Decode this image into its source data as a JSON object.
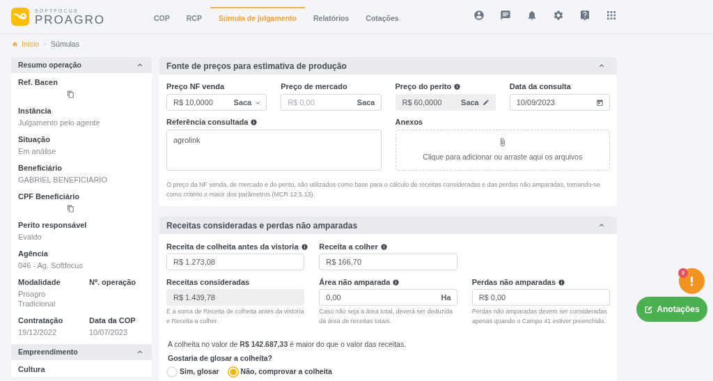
{
  "header": {
    "logo": {
      "brand": "SOFTFOCUS",
      "product": "PROAGRO"
    },
    "nav": [
      {
        "label": "COP",
        "selected": false
      },
      {
        "label": "RCP",
        "selected": false
      },
      {
        "label": "Súmula de julgamento",
        "selected": true
      },
      {
        "label": "Relatórios",
        "selected": false
      },
      {
        "label": "Cotações",
        "selected": false
      }
    ]
  },
  "breadcrumb": [
    {
      "label": "Início",
      "kind": "link"
    },
    {
      "label": "Súmulas",
      "kind": "current"
    }
  ],
  "sidebar": {
    "sections": [
      {
        "title": "Resumo operação",
        "expanded": true,
        "rows": [
          [
            {
              "label": "Ref. Bacen",
              "copyable": true
            }
          ],
          [
            {
              "label": "Instância",
              "value": "Julgamento pelo agente"
            }
          ],
          [
            {
              "label": "Situação",
              "value": "Em análise"
            }
          ],
          [
            {
              "label": "Beneficiário",
              "value": "GABRIEL BENEFICIÁRIO"
            }
          ],
          [
            {
              "label": "CPF Beneficiário",
              "copyable": true
            }
          ],
          [
            {
              "label": "Perito responsável",
              "value": "Evaldo"
            }
          ],
          [
            {
              "label": "Agência",
              "value": "046 - Ag. Softfocus"
            }
          ],
          [
            {
              "label": "Modalidade",
              "value": "Proagro Tradicional"
            },
            {
              "label": "Nº. operação"
            }
          ],
          [
            {
              "label": "Contratação",
              "value": "19/12/2022"
            },
            {
              "label": "Data da COP",
              "value": "10/07/2023"
            }
          ]
        ]
      },
      {
        "title": "Empreendimento",
        "expanded": true,
        "rows": [
          [
            {
              "label": "Cultura"
            }
          ]
        ]
      }
    ]
  },
  "price_panel": {
    "title": "Fonte de preços para estimativa de produção",
    "expanded": true,
    "fields": [
      {
        "label": "Preço NF venda",
        "kind": "select",
        "value": "R$ 10,0000",
        "unit": "Saca",
        "disabled": false
      },
      {
        "label": "Preço de mercado",
        "kind": "unit",
        "placeholder": "R$ 0,00",
        "unit": "Saca",
        "disabled": false
      },
      {
        "label": "Preço do perito",
        "info": true,
        "kind": "editable",
        "value": "R$ 60,0000",
        "unit": "Saca",
        "disabled": true
      },
      {
        "label": "Data da consulta",
        "kind": "date",
        "value": "10/09/2023",
        "disabled": false
      }
    ],
    "reference": {
      "label": "Referência consultada",
      "info": true,
      "value": "agrolink"
    },
    "attachments": {
      "label": "Anexos",
      "hint": "Clique para adicionar ou arraste aqui os arquivos"
    },
    "note": "O preço da NF venda, de mercado e do perito, são utilizados como base para o cálculo de receitas consideradas e das perdas não amparadas, tomando-se como critério o maior dos parâmetros (MCR 12.5.13)."
  },
  "revenue_panel": {
    "title": "Receitas consideradas e perdas não amparadas",
    "expanded": true,
    "rows": [
      [
        {
          "label": "Receita de colheita antes da vistoria",
          "info": true,
          "value": "R$ 1.273,08",
          "disabled": false
        },
        {
          "label": "Receita a colher",
          "info": true,
          "value": "R$ 166,70",
          "disabled": false
        }
      ],
      [
        {
          "label": "Receitas consideradas",
          "value": "R$ 1.439,78",
          "disabled": true,
          "help": "É a soma de Receita de colheita antes da vistoria e Receita a colher."
        },
        {
          "label": "Área não amparada",
          "info": true,
          "value": "0,00",
          "unit": "Ha",
          "disabled": false,
          "help": "Caso não seja a área total, deverá ser deduzida da área de receitas totais."
        },
        {
          "label": "Perdas não amparadas",
          "info": true,
          "value": "R$ 0,00",
          "disabled": false,
          "help": "Perdas não amparadas devem ser consideradas apenas quando o Campo 41 estiver preenchido."
        }
      ]
    ],
    "message": "A colheita no valor de **R$ 142.687,33** é maior do que o valor das receitas.",
    "question": "Gostaria de glosar a colheita?",
    "options": [
      {
        "label": "Sim, glosar",
        "selected": false
      },
      {
        "label": "Não, comprovar a colheita",
        "selected": true
      }
    ]
  },
  "alerts": {
    "count": "2"
  },
  "notes_button": {
    "label": "Anotações"
  }
}
